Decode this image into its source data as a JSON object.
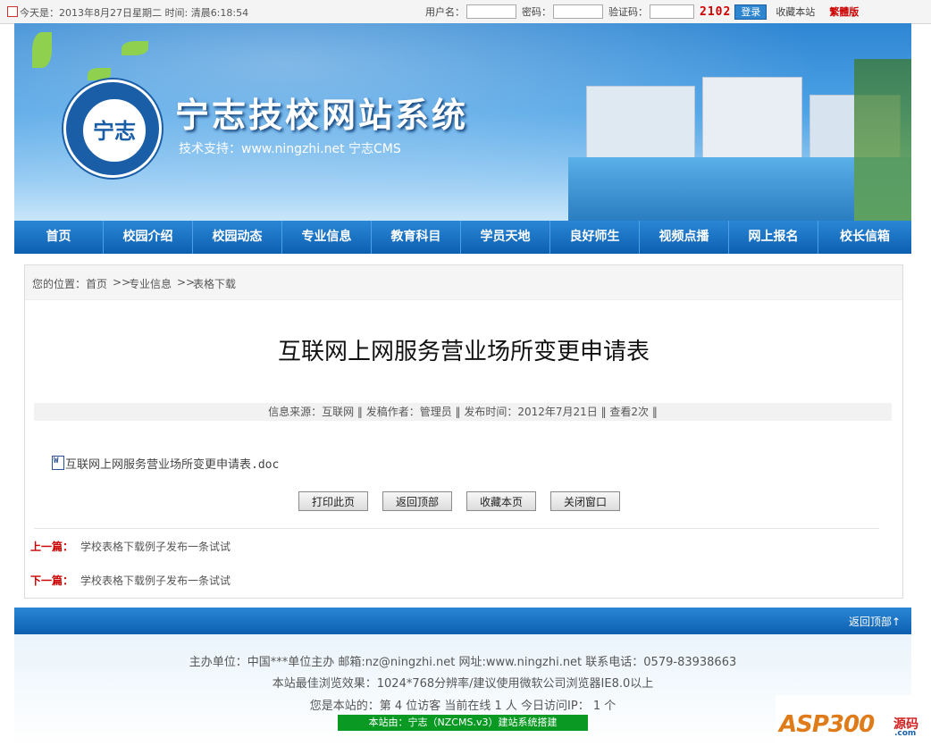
{
  "topbar": {
    "date_text": "今天是：2013年8月27日星期二  时间: 清晨6:18:54",
    "username_label": "用户名：",
    "password_label": "密码：",
    "captcha_label": "验证码：",
    "captcha_code": "2102",
    "login_button": "登录",
    "favorite_link": "收藏本站",
    "traditional_link": "繁體版"
  },
  "banner": {
    "logo_glyph": "宁志",
    "title": "宁志技校网站系统",
    "subtitle": "技术支持：www.ningzhi.net 宁志CMS"
  },
  "nav": {
    "items": [
      {
        "label": "首页"
      },
      {
        "label": "校园介绍"
      },
      {
        "label": "校园动态"
      },
      {
        "label": "专业信息"
      },
      {
        "label": "教育科目"
      },
      {
        "label": "学员天地"
      },
      {
        "label": "良好师生"
      },
      {
        "label": "视频点播"
      },
      {
        "label": "网上报名"
      },
      {
        "label": "校长信箱"
      }
    ]
  },
  "breadcrumb": {
    "label": "您的位置：",
    "home": "首页",
    "sep1": ">>",
    "section": "专业信息",
    "sep2": ">>",
    "current": "表格下载"
  },
  "article": {
    "title": "互联网上网服务营业场所变更申请表",
    "meta": "信息来源：互联网  ‖  发稿作者：管理员   ‖  发布时间：2012年7月21日  ‖  查看2次  ‖",
    "attachment": "互联网上网服务营业场所变更申请表.doc",
    "buttons": {
      "print": "打印此页",
      "back_top": "返回顶部",
      "favorite": "收藏本页",
      "close": "关闭窗口"
    },
    "prev_label": "上一篇：",
    "prev_title": "学校表格下载例子发布一条试试",
    "next_label": "下一篇：",
    "next_title": "学校表格下载例子发布一条试试"
  },
  "footer": {
    "back_top": "返回顶部↑",
    "line1": "主办单位：中国***单位主办  邮箱:nz@ningzhi.net  网址:www.ningzhi.net   联系电话：0579-83938663",
    "line2": "本站最佳浏览效果：1024*768分辨率/建议使用微软公司浏览器IE8.0以上",
    "line3": "您是本站的：第 4 位访客  当前在线 1 人 今日访问IP：  1 个",
    "powered": "本站由：宁志（NZCMS.v3）建站系统搭建"
  },
  "watermark": {
    "text": "ASP300",
    "cn": "源码",
    "domain": ".com"
  }
}
